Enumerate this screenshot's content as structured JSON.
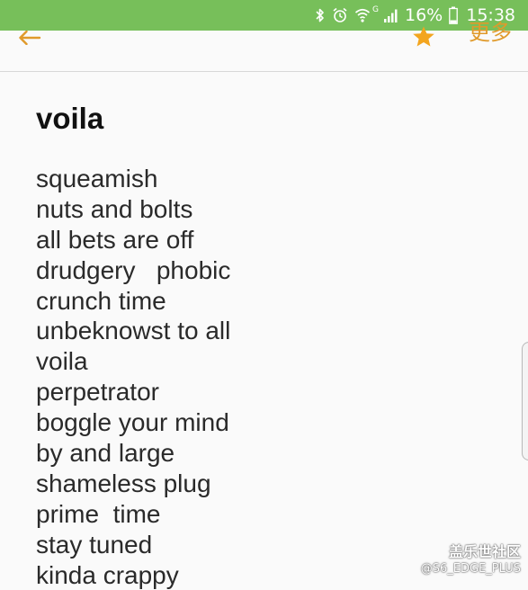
{
  "status_bar": {
    "battery_percent": "16%",
    "time": "15:38",
    "network_label": "G",
    "icons": [
      "bluetooth-icon",
      "alarm-icon",
      "wifi-icon",
      "signal-icon",
      "battery-icon"
    ],
    "background_color": "#77bf5a"
  },
  "app_bar": {
    "back_icon": "arrow-left-icon",
    "favorite_icon": "star-icon",
    "more_label": "更多",
    "accent_color": "#e09a2b"
  },
  "note": {
    "title": "voila",
    "lines": [
      "squeamish",
      "nuts and bolts",
      "all bets are off",
      "drudgery   phobic",
      "crunch time",
      "unbeknowst to all",
      "voila",
      "perpetrator",
      "boggle your mind",
      "by and large",
      "shameless plug",
      "prime  time",
      "stay tuned",
      "kinda crappy"
    ]
  },
  "watermark": {
    "title": "盖乐世社区",
    "handle": "@S6_EDGE_PLUS"
  }
}
